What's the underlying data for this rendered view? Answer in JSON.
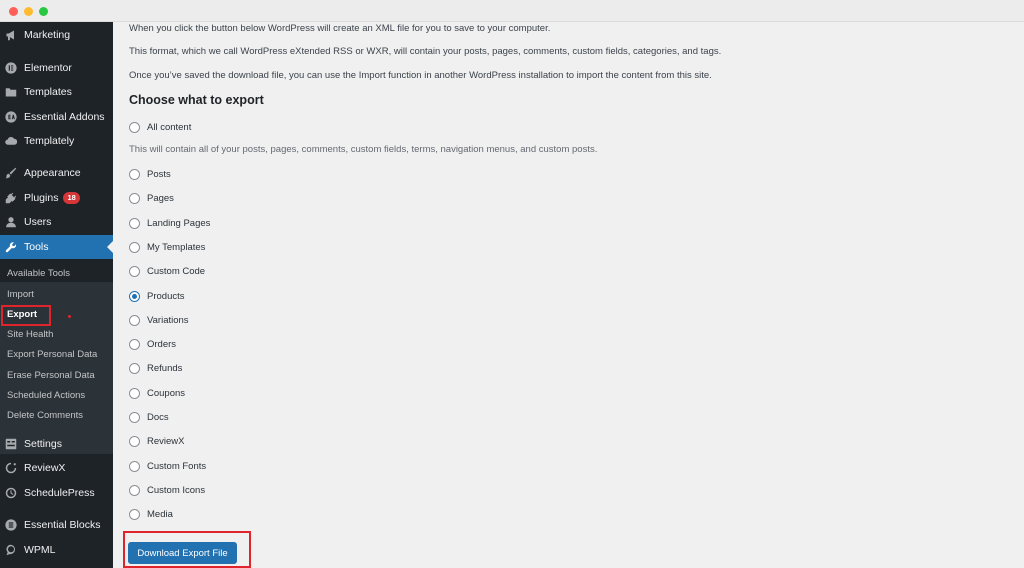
{
  "sidebar": {
    "items": [
      {
        "label": "Marketing",
        "icon": "megaphone-icon"
      },
      {
        "label": "Elementor",
        "icon": "elementor-icon"
      },
      {
        "label": "Templates",
        "icon": "folder-icon"
      },
      {
        "label": "Essential Addons",
        "icon": "ea-icon"
      },
      {
        "label": "Templately",
        "icon": "cloud-icon"
      },
      {
        "label": "Appearance",
        "icon": "brush-icon"
      },
      {
        "label": "Plugins",
        "icon": "plug-icon",
        "badge": "18"
      },
      {
        "label": "Users",
        "icon": "user-icon"
      },
      {
        "label": "Tools",
        "icon": "wrench-icon",
        "active": true
      },
      {
        "label": "Settings",
        "icon": "settings-icon"
      },
      {
        "label": "ReviewX",
        "icon": "reviewx-icon"
      },
      {
        "label": "SchedulePress",
        "icon": "clock-icon"
      },
      {
        "label": "Essential Blocks",
        "icon": "blocks-icon"
      },
      {
        "label": "WPML",
        "icon": "wpml-icon"
      }
    ],
    "submenu": [
      {
        "label": "Available Tools"
      },
      {
        "label": "Import"
      },
      {
        "label": "Export",
        "current": true
      },
      {
        "label": "Site Health"
      },
      {
        "label": "Export Personal Data"
      },
      {
        "label": "Erase Personal Data"
      },
      {
        "label": "Scheduled Actions"
      },
      {
        "label": "Delete Comments"
      }
    ]
  },
  "content": {
    "intro1": "When you click the button below WordPress will create an XML file for you to save to your computer.",
    "intro2": "This format, which we call WordPress eXtended RSS or WXR, will contain your posts, pages, comments, custom fields, categories, and tags.",
    "intro3": "Once you’ve saved the download file, you can use the Import function in another WordPress installation to import the content from this site.",
    "heading": "Choose what to export",
    "all_content_label": "All content",
    "all_content_note": "This will contain all of your posts, pages, comments, custom fields, terms, navigation menus, and custom posts.",
    "options": [
      {
        "label": "Posts",
        "checked": false
      },
      {
        "label": "Pages",
        "checked": false
      },
      {
        "label": "Landing Pages",
        "checked": false
      },
      {
        "label": "My Templates",
        "checked": false
      },
      {
        "label": "Custom Code",
        "checked": false
      },
      {
        "label": "Products",
        "checked": true
      },
      {
        "label": "Variations",
        "checked": false
      },
      {
        "label": "Orders",
        "checked": false
      },
      {
        "label": "Refunds",
        "checked": false
      },
      {
        "label": "Coupons",
        "checked": false
      },
      {
        "label": "Docs",
        "checked": false
      },
      {
        "label": "ReviewX",
        "checked": false
      },
      {
        "label": "Custom Fonts",
        "checked": false
      },
      {
        "label": "Custom Icons",
        "checked": false
      },
      {
        "label": "Media",
        "checked": false
      }
    ],
    "download_button": "Download Export File"
  },
  "colors": {
    "sidebar_bg": "#1d2327",
    "accent": "#2271b1",
    "highlight": "#e0242b",
    "badge": "#d63638"
  }
}
